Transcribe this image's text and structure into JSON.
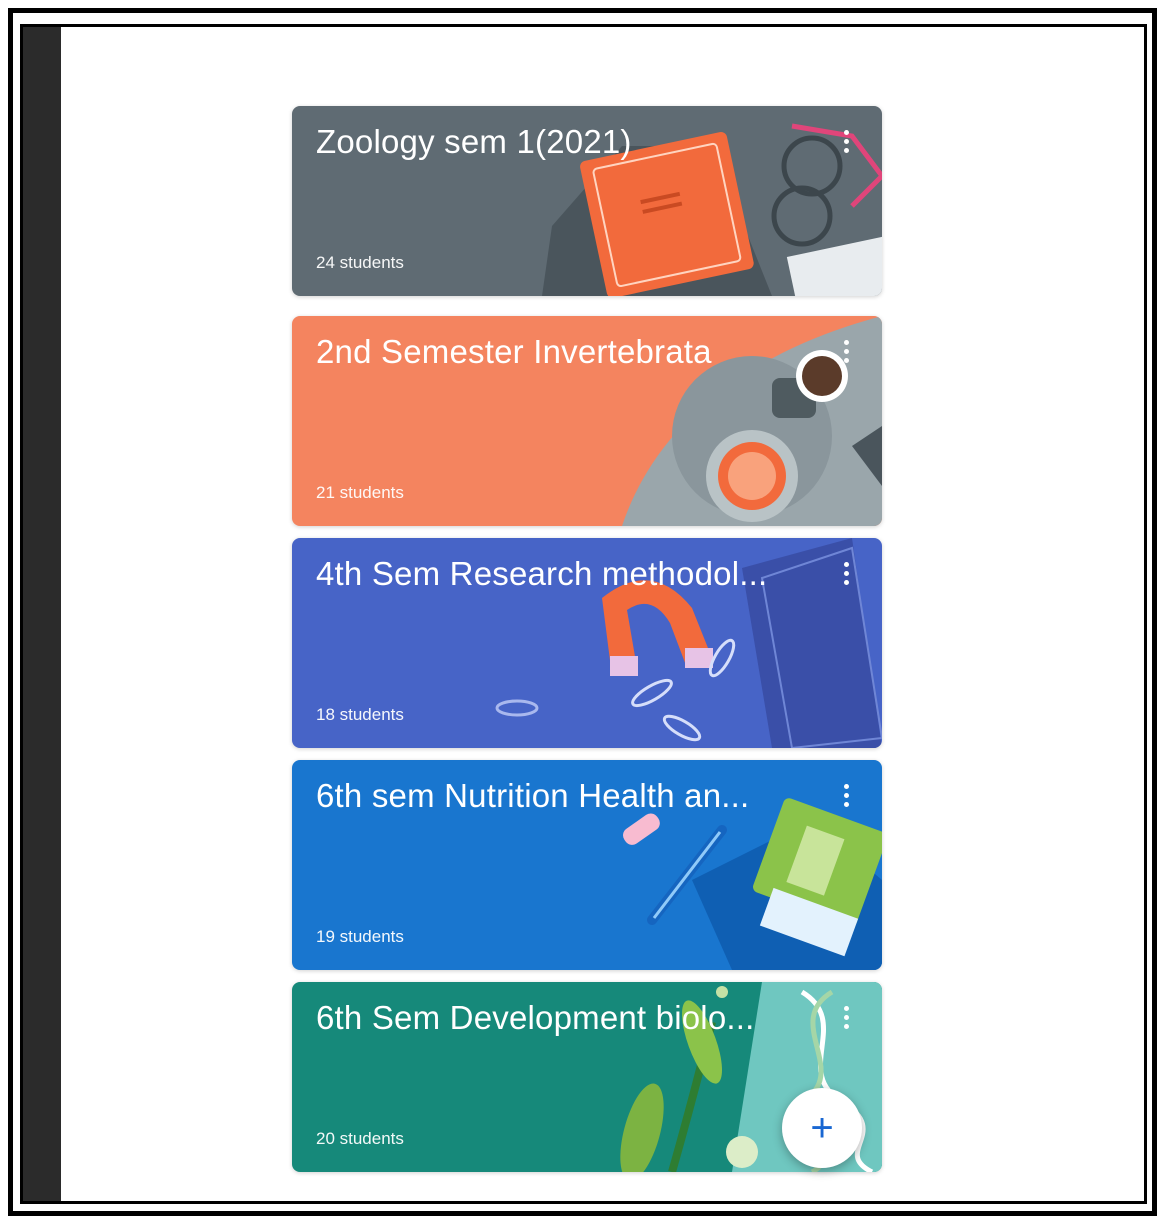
{
  "classes": [
    {
      "title": "Zoology sem 1(2021)",
      "students": "24 students",
      "color": "#5f6b73",
      "art": "book-glasses"
    },
    {
      "title": "2nd Semester Invertebrata",
      "students": "21 students",
      "color": "#f4845f",
      "art": "coffee-fruit"
    },
    {
      "title": "4th Sem Research methodol...",
      "students": "18 students",
      "color": "#4764c7",
      "art": "magnet-clips"
    },
    {
      "title": "6th sem Nutrition Health an...",
      "students": "19 students",
      "color": "#1976cf",
      "art": "notebook-pen"
    },
    {
      "title": "6th Sem Development  biolo...",
      "students": "20 students",
      "color": "#16897a",
      "art": "plant-dna"
    }
  ],
  "fab": {
    "label": "+",
    "icon": "add-icon"
  }
}
